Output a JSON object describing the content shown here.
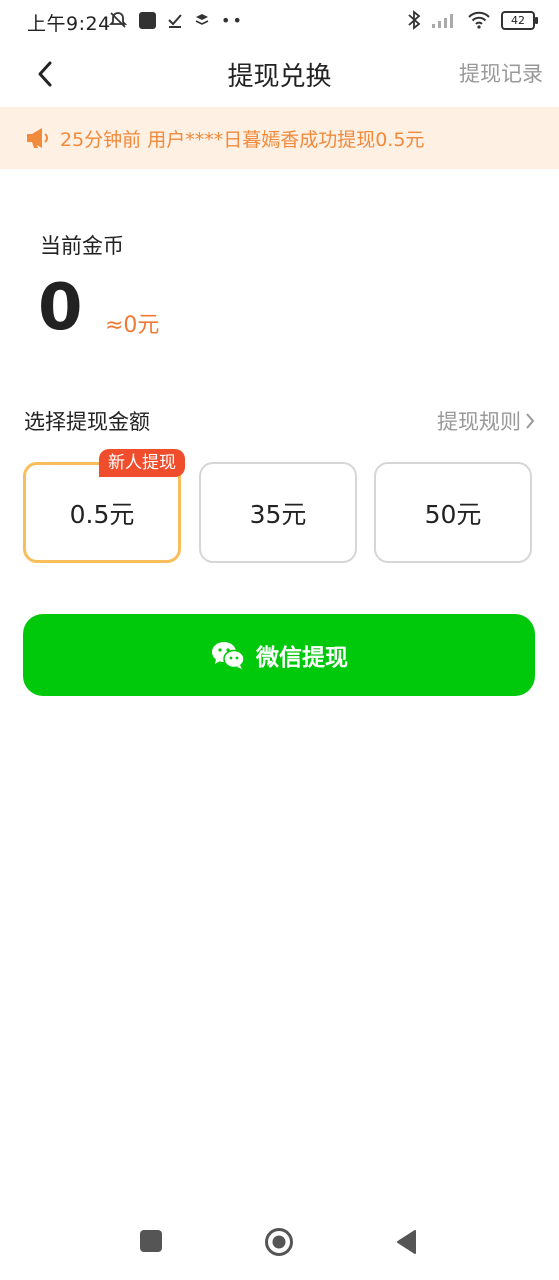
{
  "status": {
    "time": "上午9:24",
    "battery": "42"
  },
  "nav": {
    "title": "提现兑换",
    "history": "提现记录"
  },
  "notice": {
    "text": "25分钟前 用户****日暮嫣香成功提现0.5元"
  },
  "coins": {
    "label": "当前金币",
    "value": "0",
    "rmb": "≈0元"
  },
  "select": {
    "label": "选择提现金额",
    "rules": "提现规则",
    "badge": "新人提现",
    "options": [
      "0.5元",
      "35元",
      "50元"
    ],
    "selected_index": 0
  },
  "button": {
    "label": "微信提现"
  },
  "colors": {
    "accent_green": "#00c80a",
    "accent_orange": "#f07a34",
    "badge_red": "#f04d2d",
    "selected_border": "#f7be5a",
    "notice_bg": "#fff0e4"
  }
}
